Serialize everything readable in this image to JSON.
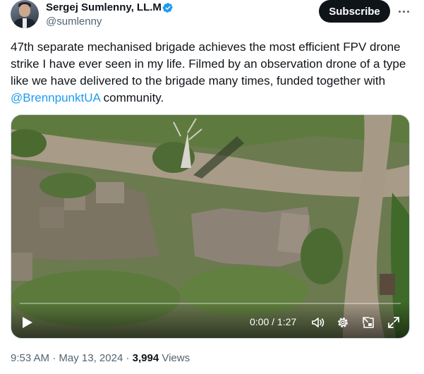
{
  "author": {
    "name": "Sergej Sumlenny, LL.M",
    "handle": "@sumlenny",
    "verified": true,
    "avatar_icon": "profile-photo"
  },
  "header": {
    "subscribe_label": "Subscribe",
    "more_icon": "more-horizontal-icon"
  },
  "tweet": {
    "text_before_mention": "47th separate mechanised brigade achieves the most efficient FPV drone strike I have ever seen in my life. Filmed by an observation drone of a type like we have delivered to the brigade many times, funded together with ",
    "mention": "@BrennpunktUA",
    "text_after_mention": " community."
  },
  "video": {
    "time": "0:00 / 1:27",
    "progress": 0,
    "icons": [
      "play-icon",
      "volume-icon",
      "settings-gear-icon",
      "picture-in-picture-icon",
      "fullscreen-icon"
    ]
  },
  "meta": {
    "time": "9:53 AM",
    "separator": "·",
    "date": "May 13, 2024",
    "views_count": "3,994",
    "views_label": "Views"
  },
  "colors": {
    "link": "#1d9bf0",
    "text": "#0f1419",
    "secondary": "#536471",
    "verified": "#1d9bf0",
    "subscribe_bg": "#0f1419"
  }
}
